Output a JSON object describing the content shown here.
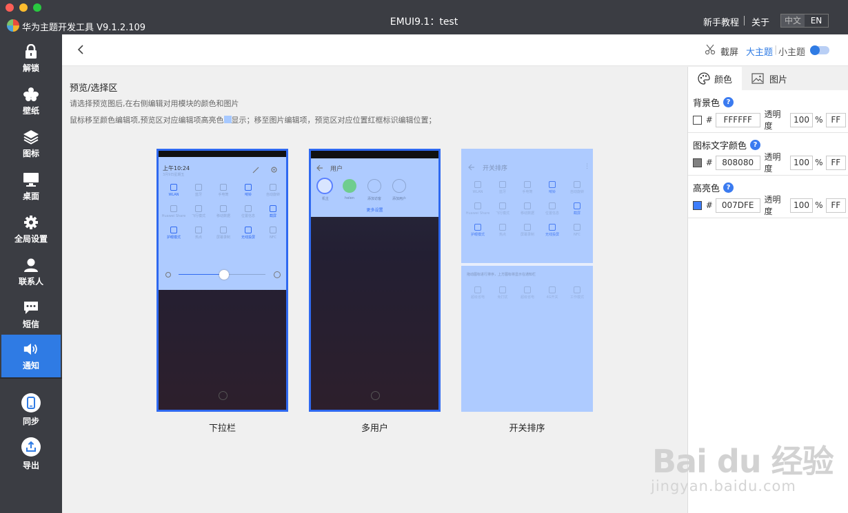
{
  "app": {
    "name": "华为主题开发工具 V9.1.2.109",
    "window_title": "EMUI9.1：test",
    "links": {
      "tutorial": "新手教程",
      "about": "关于"
    },
    "lang": {
      "zh": "中文",
      "en": "EN"
    }
  },
  "sidebar": {
    "items": [
      {
        "label": "解锁",
        "icon": "lock-icon"
      },
      {
        "label": "壁纸",
        "icon": "wallpaper-icon"
      },
      {
        "label": "图标",
        "icon": "layers-icon"
      },
      {
        "label": "桌面",
        "icon": "desktop-icon"
      },
      {
        "label": "全局设置",
        "icon": "gear-icon"
      },
      {
        "label": "联系人",
        "icon": "contact-icon"
      },
      {
        "label": "短信",
        "icon": "message-icon"
      },
      {
        "label": "通知",
        "icon": "speaker-icon",
        "active": true
      },
      {
        "label": "同步",
        "icon": "phone-sync-icon"
      },
      {
        "label": "导出",
        "icon": "export-icon"
      }
    ]
  },
  "topbar": {
    "screenshot": "截屏",
    "big_theme": "大主题",
    "small_theme": "小主题"
  },
  "preview": {
    "title": "预览/选择区",
    "hint1": "请选择预览图后,在右侧编辑对用模块的颜色和图片",
    "hint2_a": "鼠标移至颜色编辑项,预览区对应编辑项高亮色",
    "hint2_b": "显示；移至图片编辑项，预览区对应位置红框标识编辑位置；",
    "phones": [
      {
        "caption": "下拉栏",
        "time": "上午10:24",
        "date": "3月9日星期五",
        "row1": [
          "WLAN",
          "蓝牙",
          "手电筒",
          "响铃",
          "自动旋转"
        ],
        "row2": [
          "Huawei Share",
          "飞行模式",
          "移动数据",
          "位置信息",
          "截屏"
        ],
        "row3": [
          "护眼模式",
          "热点",
          "屏幕录制",
          "无线投屏",
          "NFC"
        ]
      },
      {
        "caption": "多用户",
        "header": "用户",
        "users": [
          "机主",
          "helen",
          "添加访客",
          "添加用户"
        ],
        "more": "更多设置"
      },
      {
        "caption": "开关排序",
        "header": "开关排序",
        "row1": [
          "WLAN",
          "蓝牙",
          "手电筒",
          "响铃",
          "自动旋转"
        ],
        "row2": [
          "Huawei Share",
          "飞行模式",
          "移动数据",
          "位置信息",
          "截屏"
        ],
        "row3": [
          "护眼模式",
          "热点",
          "屏幕录制",
          "无线投屏",
          "NFC"
        ],
        "drag_hint": "拖动图标进行排序，上方图标将显示在通知栏",
        "row4": [
          "超级省电",
          "免打扰",
          "超级省电",
          "4G开关",
          "工作模式"
        ]
      }
    ]
  },
  "panel": {
    "tabs": {
      "color": "颜色",
      "image": "图片"
    },
    "help": "?",
    "hash": "#",
    "opacity_label": "透明度",
    "percent": "%",
    "sections": [
      {
        "title": "背景色",
        "hex": "FFFFFF",
        "swatch": "#FFFFFF",
        "opacity": "100",
        "alpha": "FF"
      },
      {
        "title": "图标文字颜色",
        "hex": "808080",
        "swatch": "#808080",
        "opacity": "100",
        "alpha": "FF"
      },
      {
        "title": "高亮色",
        "hex": "007DFE",
        "swatch": "#3d7dfc",
        "opacity": "100",
        "alpha": "FF"
      }
    ]
  },
  "watermark": {
    "brand": "Bai du 经验",
    "url": "jingyan.baidu.com"
  },
  "colors": {
    "accent": "#2f7be4",
    "sidebar": "#3b3d43",
    "highlight": "#aecbff"
  }
}
